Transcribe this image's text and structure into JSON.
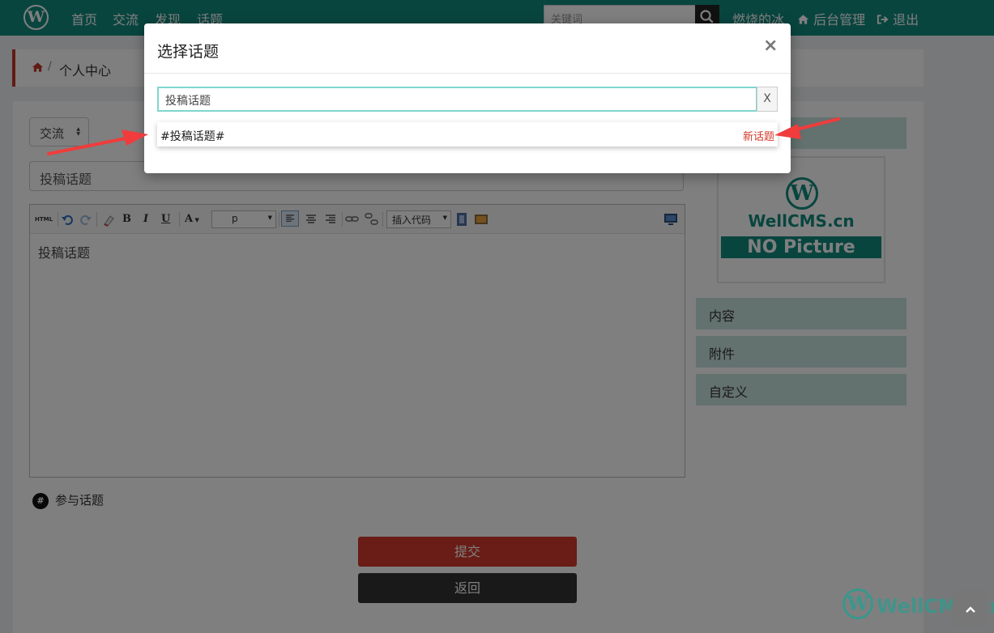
{
  "navbar": {
    "logo": "W",
    "links": [
      "首页",
      "交流",
      "发现",
      "话题"
    ],
    "search_placeholder": "关键词",
    "user": "燃烧的冰",
    "admin": "后台管理",
    "logout": "退出"
  },
  "breadcrumb": {
    "separator": "/",
    "current": "个人中心"
  },
  "form": {
    "category": "交流",
    "title_value": "投稿话题",
    "editor_content": "投稿话题",
    "toolbar": {
      "html": "HTML",
      "bold": "B",
      "italic": "I",
      "underline": "U",
      "font_color": "A",
      "paragraph": "p",
      "insert_code": "插入代码"
    },
    "join_topic_icon": "#",
    "join_topic": "参与话题",
    "submit": "提交",
    "back": "返回"
  },
  "sidebar": {
    "nopic": {
      "logo": "W",
      "brand": "WellCMS.cn",
      "label": "NO Picture"
    },
    "items": [
      "内容",
      "附件",
      "自定义"
    ]
  },
  "watermark": {
    "logo": "W",
    "text": "WellCMS.cn"
  },
  "modal": {
    "title": "选择话题",
    "close": "×",
    "input_value": "投稿话题",
    "clear": "X",
    "suggestion": "#投稿话题#",
    "new_topic": "新话题"
  },
  "colors": {
    "brand": "#138a7f",
    "danger": "#d33a2c",
    "annotation": "#f03c3c"
  }
}
